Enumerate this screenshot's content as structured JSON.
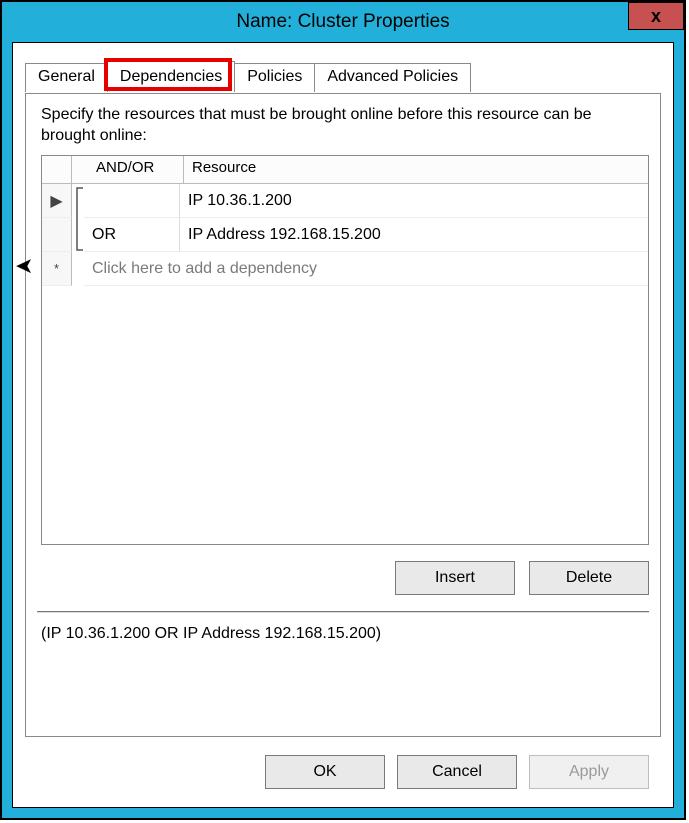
{
  "title": "Name: Cluster Properties",
  "close_label": "x",
  "tabs": {
    "general": "General",
    "dependencies": "Dependencies",
    "policies": "Policies",
    "advanced": "Advanced Policies"
  },
  "instruction": "Specify the resources that must be brought online before this resource can be brought online:",
  "grid": {
    "headers": {
      "andor": "AND/OR",
      "resource": "Resource"
    },
    "rows": [
      {
        "marker": "▶",
        "andor": "",
        "resource": "IP 10.36.1.200"
      },
      {
        "marker": "",
        "andor": "OR",
        "resource": "IP Address 192.168.15.200"
      }
    ],
    "new_row_marker": "*",
    "new_row_placeholder": "Click here to add a dependency"
  },
  "buttons": {
    "insert": "Insert",
    "delete": "Delete",
    "ok": "OK",
    "cancel": "Cancel",
    "apply": "Apply"
  },
  "expression": "(IP 10.36.1.200  OR IP Address 192.168.15.200)"
}
